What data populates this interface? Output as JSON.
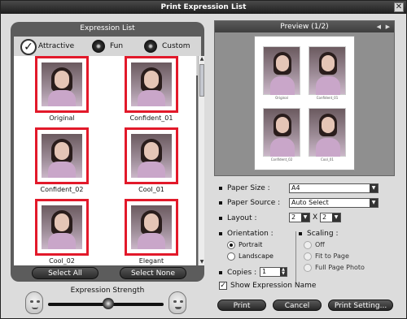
{
  "window": {
    "title": "Print Expression List"
  },
  "expression_list": {
    "header": "Expression List",
    "filters": [
      {
        "label": "Attractive",
        "state": "checked"
      },
      {
        "label": "Fun",
        "state": "unchecked"
      },
      {
        "label": "Custom",
        "state": "unchecked"
      }
    ],
    "thumbnails": [
      {
        "caption": "Original"
      },
      {
        "caption": "Confident_01"
      },
      {
        "caption": "Confident_02"
      },
      {
        "caption": "Cool_01"
      },
      {
        "caption": "Cool_02"
      },
      {
        "caption": "Elegant"
      }
    ],
    "select_all": "Select All",
    "select_none": "Select None"
  },
  "strength": {
    "label": "Expression Strength",
    "level": 0.52
  },
  "preview": {
    "title": "Preview (1/2)",
    "captions": [
      "Original",
      "Confident_01",
      "Confident_02",
      "Cool_01"
    ]
  },
  "settings": {
    "paper_size_label": "Paper Size :",
    "paper_size_value": "A4",
    "paper_source_label": "Paper Source :",
    "paper_source_value": "Auto Select",
    "layout_label": "Layout :",
    "layout_cols": "2",
    "layout_x": "X",
    "layout_rows": "2",
    "orientation_label": "Orientation :",
    "orientation_options": [
      "Portrait",
      "Landscape"
    ],
    "scaling_label": "Scaling :",
    "scaling_options": [
      "Off",
      "Fit to Page",
      "Full Page Photo"
    ],
    "copies_label": "Copies :",
    "copies_value": "1",
    "show_name_label": "Show Expression Name"
  },
  "buttons": {
    "print": "Print",
    "cancel": "Cancel",
    "print_setting": "Print Setting..."
  },
  "colors": {
    "highlight": "#e2192a",
    "panel": "#5c5c5c",
    "window": "#dcdcdc"
  }
}
